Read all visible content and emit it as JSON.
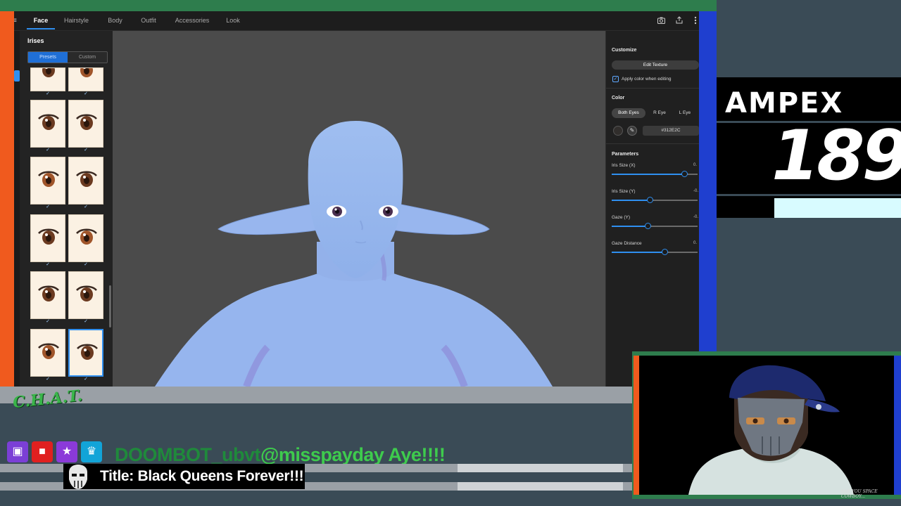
{
  "app": {
    "tabs": [
      {
        "label": "Face",
        "active": true
      },
      {
        "label": "Hairstyle",
        "active": false
      },
      {
        "label": "Body",
        "active": false
      },
      {
        "label": "Outfit",
        "active": false
      },
      {
        "label": "Accessories",
        "active": false
      },
      {
        "label": "Look",
        "active": false
      }
    ],
    "toolbar_icons": [
      "menu-icon",
      "camera-icon",
      "share-icon",
      "more-icon"
    ]
  },
  "sidebar": {
    "title": "Irises",
    "segment": {
      "presets": "Presets",
      "custom": "Custom",
      "selected": "Presets"
    },
    "selected_item_index": 11
  },
  "customize": {
    "title": "Customize",
    "edit_texture": "Edit Texture",
    "apply_color_label": "Apply color when editing",
    "apply_color_checked": true,
    "color_title": "Color",
    "eye_buttons": [
      {
        "label": "Both Eyes",
        "active": true
      },
      {
        "label": "R Eye",
        "active": false
      },
      {
        "label": "L Eye",
        "active": false
      }
    ],
    "hex_value": "#312E2C",
    "swatch_color": "#312e2c",
    "parameters_title": "Parameters",
    "parameters": [
      {
        "label": "Iris Size (X)",
        "value_text": "0.",
        "level": 0.85
      },
      {
        "label": "Iris Size (Y)",
        "value_text": "-0.",
        "level": 0.45
      },
      {
        "label": "Gaze (Y)",
        "value_text": "-0.",
        "level": 0.42
      },
      {
        "label": "Gaze Distance",
        "value_text": "0.",
        "level": 0.62
      }
    ]
  },
  "overlay": {
    "brand": "AMPEX",
    "number": "189",
    "cam_caption": "SEE YOU SPACE COWBOY...",
    "chat_logo": "C.H.A.T.",
    "chat_username": "DOOMBOT_ubvt",
    "chat_message": "@misspayday Aye!!!!",
    "stream_title": "Title: Black Queens Forever!!!",
    "badges": [
      "twitch-icon",
      "camera-icon",
      "star-icon",
      "crown-icon"
    ],
    "colors": {
      "green": "#2e7d4d",
      "orange": "#f05a1e",
      "blue": "#1f3fcf",
      "chat_green": "#3ecb4d",
      "accent": "#2f8ff0"
    }
  }
}
